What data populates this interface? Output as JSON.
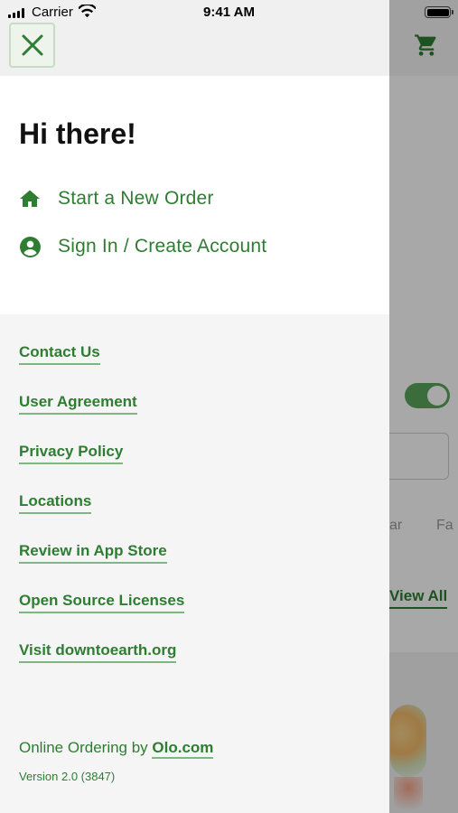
{
  "status_bar": {
    "carrier": "Carrier",
    "time": "9:41 AM"
  },
  "drawer": {
    "greeting": "Hi there!",
    "primary_items": [
      {
        "label": "Start a New Order",
        "icon": "home-icon"
      },
      {
        "label": "Sign In / Create Account",
        "icon": "account-circle-icon"
      }
    ],
    "links": [
      "Contact Us",
      "User Agreement",
      "Privacy Policy",
      "Locations",
      "Review in App Store",
      "Open Source Licenses",
      "Visit downtoearth.org"
    ],
    "footer": {
      "prefix": "Online Ordering by ",
      "brand_link": "Olo.com",
      "version": "Version 2.0 (3847)"
    }
  },
  "background": {
    "tabs": [
      "ar",
      "Fa"
    ],
    "view_all": "View All"
  },
  "colors": {
    "accent": "#2e7d32",
    "overlay": "rgba(0,0,0,0.34)"
  }
}
